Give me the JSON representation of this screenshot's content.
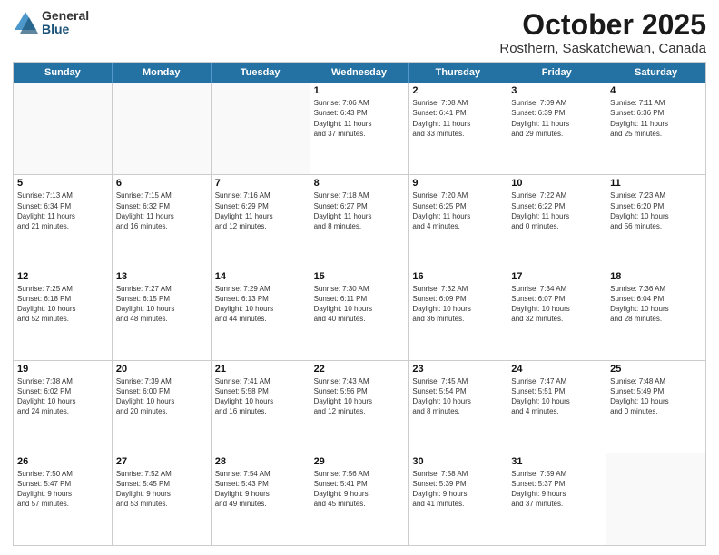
{
  "header": {
    "logo_general": "General",
    "logo_blue": "Blue",
    "title": "October 2025",
    "subtitle": "Rosthern, Saskatchewan, Canada"
  },
  "days_of_week": [
    "Sunday",
    "Monday",
    "Tuesday",
    "Wednesday",
    "Thursday",
    "Friday",
    "Saturday"
  ],
  "weeks": [
    [
      {
        "day": "",
        "info": ""
      },
      {
        "day": "",
        "info": ""
      },
      {
        "day": "",
        "info": ""
      },
      {
        "day": "1",
        "info": "Sunrise: 7:06 AM\nSunset: 6:43 PM\nDaylight: 11 hours\nand 37 minutes."
      },
      {
        "day": "2",
        "info": "Sunrise: 7:08 AM\nSunset: 6:41 PM\nDaylight: 11 hours\nand 33 minutes."
      },
      {
        "day": "3",
        "info": "Sunrise: 7:09 AM\nSunset: 6:39 PM\nDaylight: 11 hours\nand 29 minutes."
      },
      {
        "day": "4",
        "info": "Sunrise: 7:11 AM\nSunset: 6:36 PM\nDaylight: 11 hours\nand 25 minutes."
      }
    ],
    [
      {
        "day": "5",
        "info": "Sunrise: 7:13 AM\nSunset: 6:34 PM\nDaylight: 11 hours\nand 21 minutes."
      },
      {
        "day": "6",
        "info": "Sunrise: 7:15 AM\nSunset: 6:32 PM\nDaylight: 11 hours\nand 16 minutes."
      },
      {
        "day": "7",
        "info": "Sunrise: 7:16 AM\nSunset: 6:29 PM\nDaylight: 11 hours\nand 12 minutes."
      },
      {
        "day": "8",
        "info": "Sunrise: 7:18 AM\nSunset: 6:27 PM\nDaylight: 11 hours\nand 8 minutes."
      },
      {
        "day": "9",
        "info": "Sunrise: 7:20 AM\nSunset: 6:25 PM\nDaylight: 11 hours\nand 4 minutes."
      },
      {
        "day": "10",
        "info": "Sunrise: 7:22 AM\nSunset: 6:22 PM\nDaylight: 11 hours\nand 0 minutes."
      },
      {
        "day": "11",
        "info": "Sunrise: 7:23 AM\nSunset: 6:20 PM\nDaylight: 10 hours\nand 56 minutes."
      }
    ],
    [
      {
        "day": "12",
        "info": "Sunrise: 7:25 AM\nSunset: 6:18 PM\nDaylight: 10 hours\nand 52 minutes."
      },
      {
        "day": "13",
        "info": "Sunrise: 7:27 AM\nSunset: 6:15 PM\nDaylight: 10 hours\nand 48 minutes."
      },
      {
        "day": "14",
        "info": "Sunrise: 7:29 AM\nSunset: 6:13 PM\nDaylight: 10 hours\nand 44 minutes."
      },
      {
        "day": "15",
        "info": "Sunrise: 7:30 AM\nSunset: 6:11 PM\nDaylight: 10 hours\nand 40 minutes."
      },
      {
        "day": "16",
        "info": "Sunrise: 7:32 AM\nSunset: 6:09 PM\nDaylight: 10 hours\nand 36 minutes."
      },
      {
        "day": "17",
        "info": "Sunrise: 7:34 AM\nSunset: 6:07 PM\nDaylight: 10 hours\nand 32 minutes."
      },
      {
        "day": "18",
        "info": "Sunrise: 7:36 AM\nSunset: 6:04 PM\nDaylight: 10 hours\nand 28 minutes."
      }
    ],
    [
      {
        "day": "19",
        "info": "Sunrise: 7:38 AM\nSunset: 6:02 PM\nDaylight: 10 hours\nand 24 minutes."
      },
      {
        "day": "20",
        "info": "Sunrise: 7:39 AM\nSunset: 6:00 PM\nDaylight: 10 hours\nand 20 minutes."
      },
      {
        "day": "21",
        "info": "Sunrise: 7:41 AM\nSunset: 5:58 PM\nDaylight: 10 hours\nand 16 minutes."
      },
      {
        "day": "22",
        "info": "Sunrise: 7:43 AM\nSunset: 5:56 PM\nDaylight: 10 hours\nand 12 minutes."
      },
      {
        "day": "23",
        "info": "Sunrise: 7:45 AM\nSunset: 5:54 PM\nDaylight: 10 hours\nand 8 minutes."
      },
      {
        "day": "24",
        "info": "Sunrise: 7:47 AM\nSunset: 5:51 PM\nDaylight: 10 hours\nand 4 minutes."
      },
      {
        "day": "25",
        "info": "Sunrise: 7:48 AM\nSunset: 5:49 PM\nDaylight: 10 hours\nand 0 minutes."
      }
    ],
    [
      {
        "day": "26",
        "info": "Sunrise: 7:50 AM\nSunset: 5:47 PM\nDaylight: 9 hours\nand 57 minutes."
      },
      {
        "day": "27",
        "info": "Sunrise: 7:52 AM\nSunset: 5:45 PM\nDaylight: 9 hours\nand 53 minutes."
      },
      {
        "day": "28",
        "info": "Sunrise: 7:54 AM\nSunset: 5:43 PM\nDaylight: 9 hours\nand 49 minutes."
      },
      {
        "day": "29",
        "info": "Sunrise: 7:56 AM\nSunset: 5:41 PM\nDaylight: 9 hours\nand 45 minutes."
      },
      {
        "day": "30",
        "info": "Sunrise: 7:58 AM\nSunset: 5:39 PM\nDaylight: 9 hours\nand 41 minutes."
      },
      {
        "day": "31",
        "info": "Sunrise: 7:59 AM\nSunset: 5:37 PM\nDaylight: 9 hours\nand 37 minutes."
      },
      {
        "day": "",
        "info": ""
      }
    ]
  ]
}
